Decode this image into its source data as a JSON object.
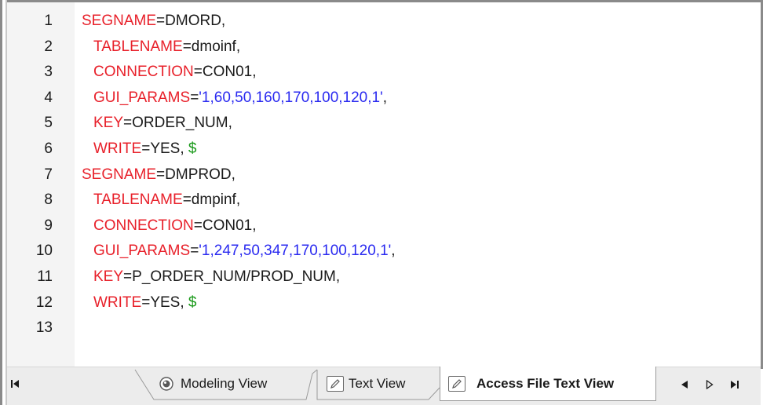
{
  "editor": {
    "line_numbers": [
      "1",
      "2",
      "3",
      "4",
      "5",
      "6",
      "7",
      "8",
      "9",
      "10",
      "11",
      "12",
      "13"
    ],
    "lines": [
      {
        "key": "SEGNAME",
        "value": "DMORD,",
        "indent": false
      },
      {
        "key": "TABLENAME",
        "value": "dmoinf,",
        "indent": true
      },
      {
        "key": "CONNECTION",
        "value": "CON01,",
        "indent": true
      },
      {
        "key": "GUI_PARAMS",
        "string": "'1,60,50,160,170,100,120,1'",
        "value": ",",
        "indent": true
      },
      {
        "key": "KEY",
        "value": "ORDER_NUM,",
        "indent": true
      },
      {
        "key": "WRITE",
        "value": "YES, ",
        "dollar": "$",
        "indent": true
      },
      {
        "key": "SEGNAME",
        "value": "DMPROD,",
        "indent": false
      },
      {
        "key": "TABLENAME",
        "value": "dmpinf,",
        "indent": true
      },
      {
        "key": "CONNECTION",
        "value": "CON01,",
        "indent": true
      },
      {
        "key": "GUI_PARAMS",
        "string": "'1,247,50,347,170,100,120,1'",
        "value": ",",
        "indent": true
      },
      {
        "key": "KEY",
        "value": "P_ORDER_NUM/PROD_NUM,",
        "indent": true
      },
      {
        "key": "WRITE",
        "value": "YES, ",
        "dollar": "$",
        "indent": true
      }
    ],
    "operator": "="
  },
  "tabs": {
    "modeling_label": "Modeling View",
    "text_label": "Text View",
    "access_label": "Access File Text View",
    "active": "Access File Text View"
  },
  "navigation": {
    "first_glyph": "⏮",
    "prev_glyph": "◀",
    "next_glyph": "▷",
    "last_glyph": "⏭"
  },
  "colors": {
    "keyword": "#e8202a",
    "string": "#2a2af0",
    "dollar": "#1a9a1a",
    "text": "#1a1a1a",
    "gutter": "#f4f4f4"
  }
}
